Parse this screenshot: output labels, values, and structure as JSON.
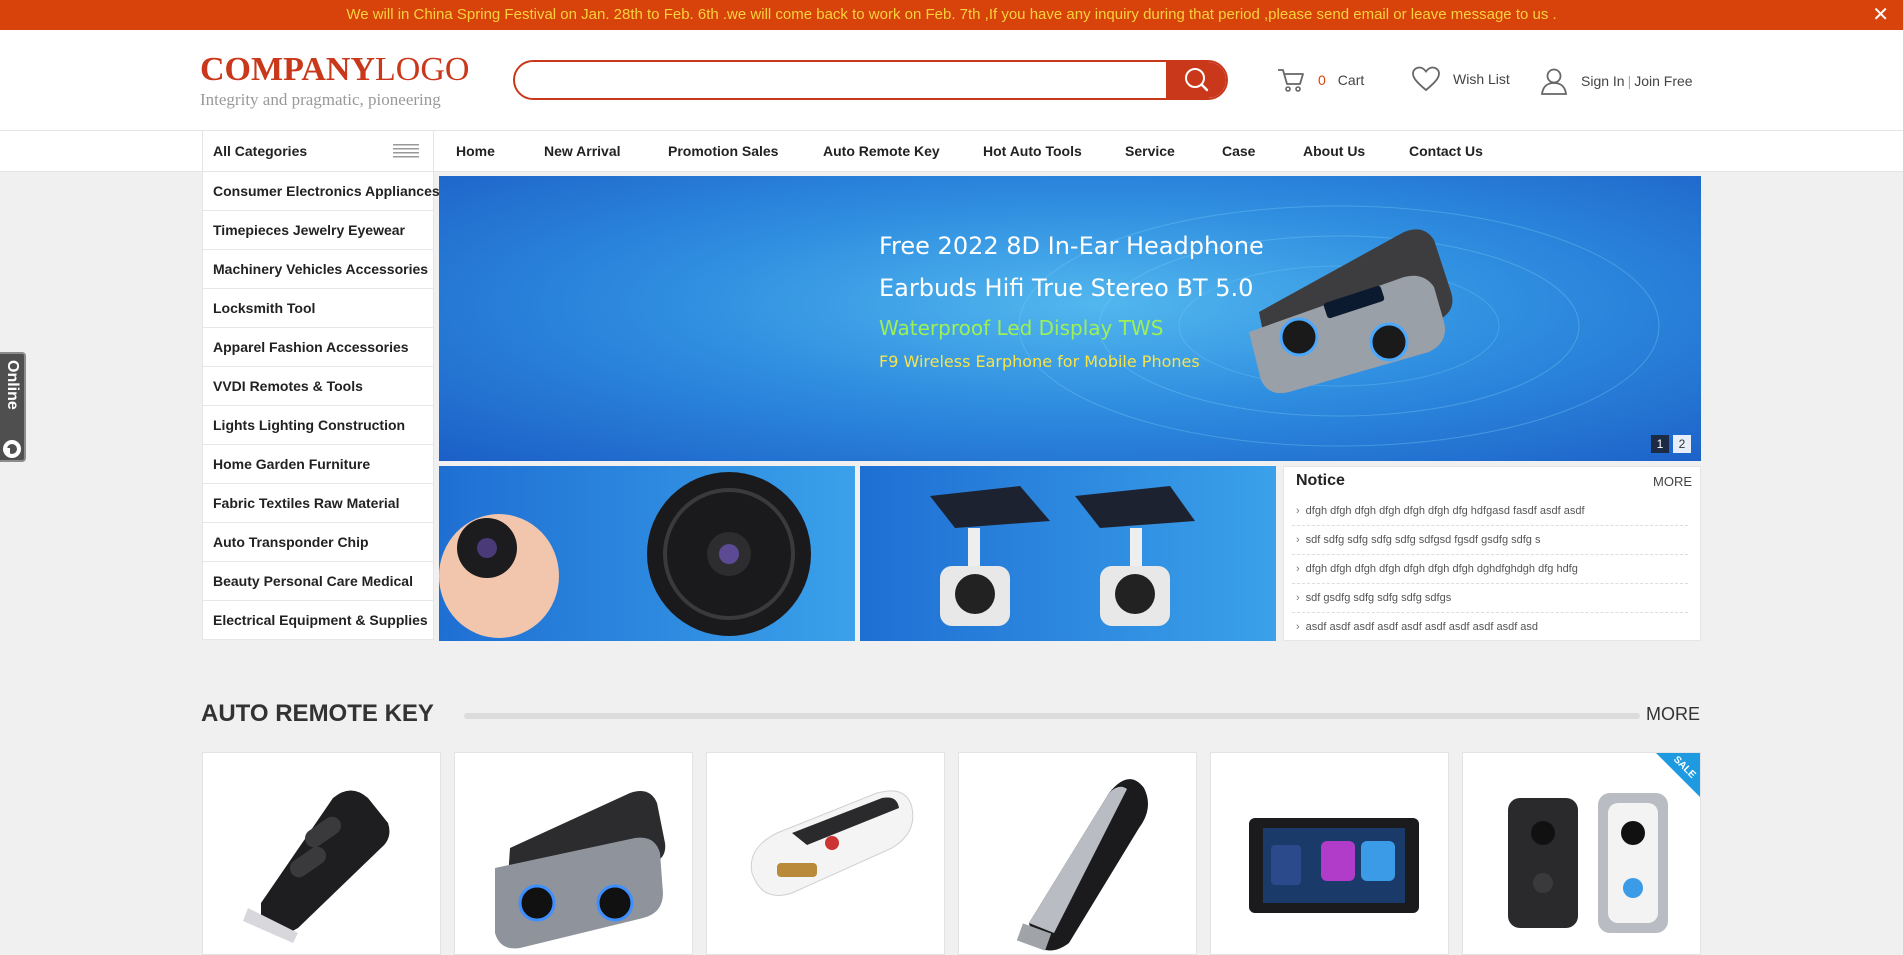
{
  "notice_bar": {
    "message": "We will in China Spring Festival on Jan. 28th to Feb. 6th .we will come back to work on Feb. 7th ,If you have any inquiry during that period ,please send email or leave message to us .",
    "close_symbol": "✕"
  },
  "header": {
    "logo_company": "COMPANY",
    "logo_word": "LOGO",
    "logo_tagline": "Integrity and pragmatic, pioneering",
    "search": {
      "value": "",
      "placeholder": ""
    },
    "cart": {
      "count": "0",
      "label": "Cart",
      "icon": "cart-icon"
    },
    "wishlist": {
      "label": "Wish List",
      "icon": "heart-icon"
    },
    "account": {
      "sign_in": "Sign In",
      "separator": "|",
      "join": "Join Free",
      "icon": "user-icon"
    }
  },
  "nav": {
    "all_categories": "All Categories",
    "links": [
      "Home",
      "New Arrival",
      "Promotion Sales",
      "Auto Remote Key",
      "Hot Auto Tools",
      "Service",
      "Case",
      "About Us",
      "Contact Us"
    ]
  },
  "sidebar": {
    "categories": [
      "Consumer Electronics Appliances",
      "Timepieces Jewelry Eyewear",
      "Machinery Vehicles Accessories",
      "Locksmith Tool",
      "Apparel Fashion Accessories",
      "VVDI Remotes & Tools",
      "Lights Lighting Construction",
      "Home Garden Furniture",
      "Fabric Textiles Raw Material",
      "Auto Transponder Chip",
      "Beauty Personal Care Medical",
      "Electrical Equipment & Supplies"
    ]
  },
  "online_tab": {
    "label": "Online"
  },
  "banner": {
    "line1": "Free 2022 8D In-Ear Headphone",
    "line2": "Earbuds Hifi True Stereo BT 5.0",
    "line3": "Waterproof Led Display TWS",
    "line4": "F9 Wireless Earphone for Mobile Phones",
    "pages": [
      "1",
      "2"
    ],
    "active_page": "1"
  },
  "notice": {
    "title": "Notice",
    "more": "MORE",
    "items": [
      "dfgh dfgh dfgh dfgh dfgh dfgh dfg hdfgasd fasdf asdf asdf",
      "sdf sdfg sdfg sdfg sdfg sdfgsd fgsdf gsdfg sdfg s",
      "dfgh dfgh dfgh dfgh dfgh dfgh dfgh dghdfghdgh dfg hdfg",
      "sdf gsdfg sdfg sdfg sdfg sdfgs",
      "asdf asdf asdf asdf asdf asdf asdf asdf asdf asd"
    ]
  },
  "section": {
    "title": "AUTO REMOTE KEY",
    "more": "MORE",
    "sale_badge": "SALE",
    "products": [
      "flip-key-product",
      "earbuds-product",
      "smart-key-product",
      "slim-key-product",
      "car-stereo-product",
      "doorbell-product"
    ]
  },
  "colors": {
    "accent": "#c9381a",
    "notice_bar": "#d8420b",
    "notice_text": "#f7d23c",
    "banner_blue": "#2f8ee0",
    "sale_blue": "#1e9be0"
  }
}
